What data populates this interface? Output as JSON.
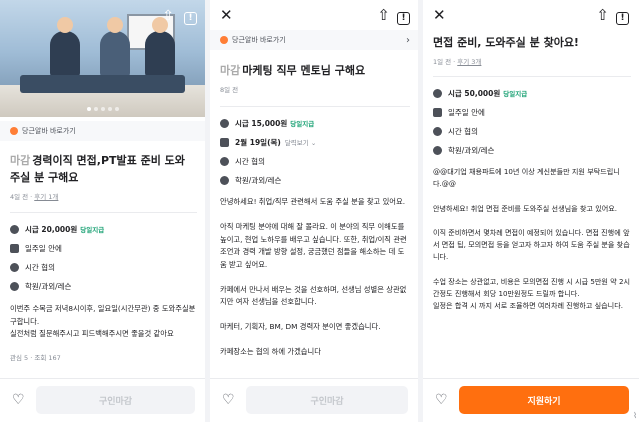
{
  "panel1": {
    "hero_dots": 5,
    "alba_link": "당근알바 바로가기",
    "badge": "마감",
    "title": "경력이직 면접,PT발표 준비 도와주실 분 구해요",
    "meta": {
      "time": "4일 전",
      "dot": "·",
      "reviews": "후기 1개"
    },
    "info": [
      {
        "icon": "coin-icon",
        "text": "시급 20,000원",
        "tag": "당일지급"
      },
      {
        "icon": "calendar-icon",
        "text": "일주일 안에"
      },
      {
        "icon": "clock-icon",
        "text": "시간 협의"
      },
      {
        "icon": "location-icon",
        "text": "학원/과외/레슨"
      }
    ],
    "body": "이번주 수목금 저녁8시이후, 일요일(시간무관) 중 도와주실분 구합니다.\n실전처럼 질문해주시고 피드백해주시면 좋을것 같아요",
    "stats": "관심 5 · 조회 167",
    "cta": "구인마감"
  },
  "panel2": {
    "alba_link": "당근알바 바로가기",
    "badge": "마감",
    "title": "마케팅 직무 멘토님 구해요",
    "meta": {
      "time": "8일 전"
    },
    "info": [
      {
        "icon": "coin-icon",
        "text": "시급 15,000원",
        "tag": "당일지급"
      },
      {
        "icon": "calendar-icon",
        "text": "2월 19일(목)",
        "sub": "달력보기 ⌄"
      },
      {
        "icon": "clock-icon",
        "text": "시간 협의"
      },
      {
        "icon": "location-icon",
        "text": "학원/과외/레슨"
      }
    ],
    "body": "안녕하세요! 취업/직무 관련해서 도움 주실 분을 찾고 있어요.\n\n아직 마케팅 분야에 대해 잘 몰라요. 이 분야의 직무 이해도를 높이고, 현업 노하우를 배우고 싶습니다. 또한, 취업/이직 관련 조언과 경력 개발 방향 설정, 궁금했던 점들을 해소하는 데 도움 받고 싶어요.\n\n카페에서 만나서 배우는 것을 선호하며, 선생님 성별은 상관없지만 여자 선생님을 선호합니다.\n\n마케터, 기획자, BM, DM 경력자 분이면 좋겠습니다.\n\n카페장소는 협의 하에 가겠습니다",
    "cta": "구인마감"
  },
  "panel3": {
    "title": "면접 준비, 도와주실 분 찾아요!",
    "meta": {
      "time": "1일 전",
      "dot": "·",
      "reviews": "후기 3개"
    },
    "info": [
      {
        "icon": "coin-icon",
        "text": "시급 50,000원",
        "tag": "당일지급"
      },
      {
        "icon": "calendar-icon",
        "text": "일주일 안에"
      },
      {
        "icon": "clock-icon",
        "text": "시간 협의"
      },
      {
        "icon": "location-icon",
        "text": "학원/과외/레슨"
      }
    ],
    "body": "@@대기업 채용파트에 10년 이상 계신분들만 지원 부탁드립니다.@@\n\n안녕하세요! 취업 면접 준비를 도와주실 선생님을 찾고 있어요.\n\n이직 준비하면서 몇차례 면접이 예정되어 있습니다. 면접 진행에 앞서 면접 팁, 모의면접 등을 얻고자 하고자 하여 도움 주실 분을 찾습니다.\n\n수업 장소는 상관없고, 비용은 모의면접 진행 시 시급 5만원 약 2시간정도 진행해서 회당 10만원정도 드릴까 합니다.\n일정은 합격 시 까지 서로 조율하면 여러차례 진행하고 싶습니다.",
    "cta": "지원하기"
  },
  "colors": {
    "accent": "#ff6f0f",
    "green": "#1aa174",
    "muted": "#868b94"
  }
}
